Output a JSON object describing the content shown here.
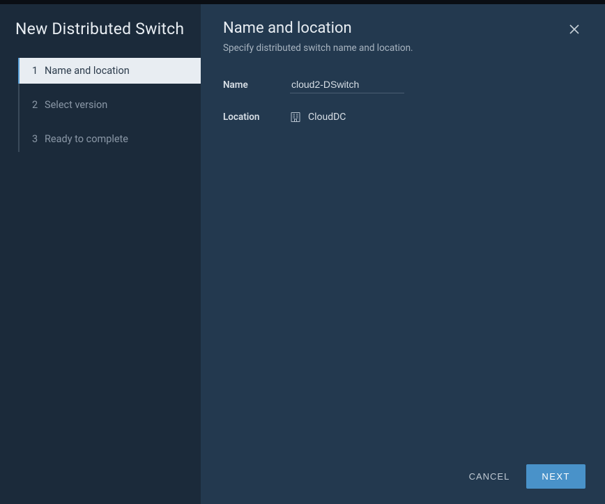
{
  "sidebar": {
    "title": "New Distributed Switch",
    "steps": [
      {
        "num": "1",
        "label": "Name and location",
        "active": true
      },
      {
        "num": "2",
        "label": "Select version",
        "active": false
      },
      {
        "num": "3",
        "label": "Ready to complete",
        "active": false
      }
    ]
  },
  "main": {
    "title": "Name and location",
    "subtitle": "Specify distributed switch name and location.",
    "form": {
      "name_label": "Name",
      "name_value": "cloud2-DSwitch",
      "location_label": "Location",
      "location_value": "CloudDC"
    }
  },
  "footer": {
    "cancel": "CANCEL",
    "next": "NEXT"
  }
}
